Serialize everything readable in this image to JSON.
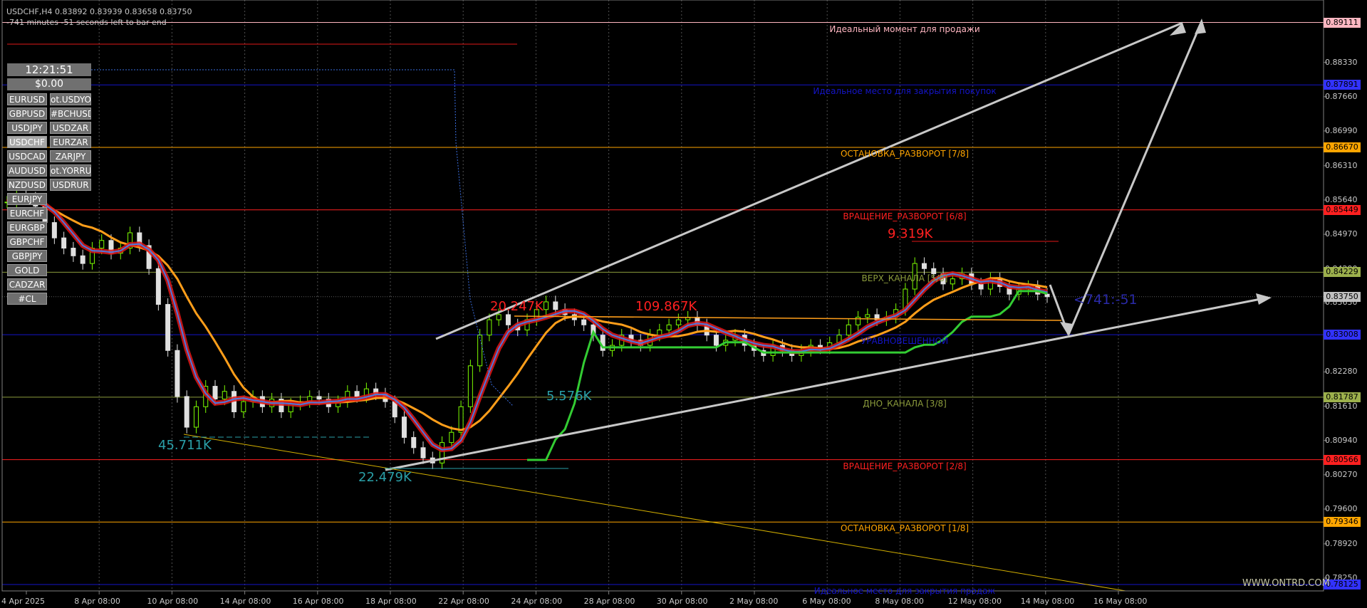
{
  "header": {
    "symbol_line": "USDCHF,H4  0.83892 0.83939 0.83658 0.83750",
    "timer_line": "-741 minutes -51 seconds left to bar end"
  },
  "panel": {
    "clock": "12:21:51",
    "balance": "$0.00",
    "symbols": [
      {
        "label": "EURUSD",
        "active": false
      },
      {
        "label": "ot.USDYO",
        "active": false
      },
      {
        "label": "GBPUSD",
        "active": false
      },
      {
        "label": "#BCHUSD",
        "active": false
      },
      {
        "label": "USDJPY",
        "active": false
      },
      {
        "label": "USDZAR",
        "active": false
      },
      {
        "label": "USDCHF",
        "active": true
      },
      {
        "label": "EURZAR",
        "active": false
      },
      {
        "label": "USDCAD",
        "active": false
      },
      {
        "label": "ZARJPY",
        "active": false
      },
      {
        "label": "AUDUSD",
        "active": false
      },
      {
        "label": "ot.YORRU",
        "active": false
      },
      {
        "label": "NZDUSD",
        "active": false
      },
      {
        "label": "USDRUR",
        "active": false
      },
      {
        "label": "EURJPY",
        "active": false
      },
      {
        "label": "",
        "active": false
      },
      {
        "label": "EURCHF",
        "active": false
      },
      {
        "label": "",
        "active": false
      },
      {
        "label": "EURGBP",
        "active": false
      },
      {
        "label": "",
        "active": false
      },
      {
        "label": "GBPCHF",
        "active": false
      },
      {
        "label": "",
        "active": false
      },
      {
        "label": "GBPJPY",
        "active": false
      },
      {
        "label": "",
        "active": false
      },
      {
        "label": "GOLD",
        "active": false
      },
      {
        "label": "",
        "active": false
      },
      {
        "label": "CADZAR",
        "active": false
      },
      {
        "label": "",
        "active": false
      },
      {
        "label": "#CL",
        "active": false
      },
      {
        "label": "",
        "active": false
      }
    ]
  },
  "watermark": "WWW.ONTRD.COM",
  "chart_data": {
    "type": "candlestick",
    "symbol": "USDCHF",
    "timeframe": "H4",
    "ylim": [
      0.78,
      0.8955
    ],
    "y_ticks": [
      "0.88330",
      "0.87660",
      "0.86990",
      "0.86310",
      "0.85640",
      "0.84970",
      "0.84290",
      "0.83630",
      "0.82950",
      "0.82280",
      "0.81610",
      "0.80940",
      "0.80270",
      "0.79600",
      "0.78920",
      "0.78250"
    ],
    "x_ticks": [
      "4 Apr 2025",
      "8 Apr 08:00",
      "10 Apr 08:00",
      "14 Apr 08:00",
      "16 Apr 08:00",
      "18 Apr 08:00",
      "22 Apr 08:00",
      "24 Apr 08:00",
      "28 Apr 08:00",
      "30 Apr 08:00",
      "2 May 08:00",
      "6 May 08:00",
      "8 May 08:00",
      "12 May 08:00",
      "14 May 08:00",
      "16 May 08:00"
    ],
    "close_series": [
      0.856,
      0.8575,
      0.8568,
      0.8552,
      0.852,
      0.849,
      0.847,
      0.8455,
      0.844,
      0.847,
      0.8485,
      0.846,
      0.847,
      0.85,
      0.8475,
      0.843,
      0.836,
      0.827,
      0.818,
      0.812,
      0.816,
      0.82,
      0.8175,
      0.819,
      0.815,
      0.817,
      0.818,
      0.816,
      0.8175,
      0.815,
      0.8165,
      0.817,
      0.818,
      0.8175,
      0.816,
      0.817,
      0.819,
      0.818,
      0.8195,
      0.8185,
      0.817,
      0.814,
      0.81,
      0.808,
      0.806,
      0.805,
      0.809,
      0.811,
      0.816,
      0.824,
      0.83,
      0.833,
      0.834,
      0.832,
      0.831,
      0.833,
      0.835,
      0.8365,
      0.835,
      0.834,
      0.833,
      0.832,
      0.83,
      0.827,
      0.828,
      0.83,
      0.829,
      0.828,
      0.83,
      0.831,
      0.832,
      0.833,
      0.8335,
      0.832,
      0.83,
      0.828,
      0.829,
      0.83,
      0.828,
      0.827,
      0.826,
      0.828,
      0.827,
      0.826,
      0.827,
      0.828,
      0.8275,
      0.8285,
      0.83,
      0.832,
      0.8335,
      0.834,
      0.833,
      0.8335,
      0.835,
      0.839,
      0.844,
      0.843,
      0.842,
      0.84,
      0.841,
      0.842,
      0.84,
      0.839,
      0.841,
      0.8395,
      0.838,
      0.839,
      0.8395,
      0.838,
      0.8375
    ],
    "levels": [
      {
        "price": "0.89111",
        "label": "Идеальный момент для продажи",
        "color": "#ffb6c1",
        "tag_bg": "#ffb6c1"
      },
      {
        "price": "0.87891",
        "label": "Идеальное место для закрытия покупок",
        "color": "#1414c8",
        "tag_bg": "#3232ff"
      },
      {
        "price": "0.86670",
        "label": "ОСТАНОВКА_РАЗВОРОТ [7/8]",
        "color": "#ffa500",
        "tag_bg": "#ffa500"
      },
      {
        "price": "0.85449",
        "label": "ВРАЩЕНИЕ_РАЗВОРОТ [6/8]",
        "color": "#ff2020",
        "tag_bg": "#ff2020"
      },
      {
        "price": "0.84229",
        "label": "ВЕРХ_КАНАЛА [5/8]",
        "color": "#8c9c3c",
        "tag_bg": "#9cb04c"
      },
      {
        "price": "0.83008",
        "label": "УРАВНОВЕШЕННОЙ",
        "color": "#1414c8",
        "tag_bg": "#3232ff"
      },
      {
        "price": "0.81787",
        "label": "ДНО_КАНАЛА [3/8]",
        "color": "#8c9c3c",
        "tag_bg": "#9cb04c"
      },
      {
        "price": "0.80566",
        "label": "ВРАЩЕНИЕ_РАЗВОРОТ [2/8]",
        "color": "#ff2020",
        "tag_bg": "#ff2020"
      },
      {
        "price": "0.79346",
        "label": "ОСТАНОВКА_РАЗВОРОТ [1/8]",
        "color": "#ffa500",
        "tag_bg": "#ffa500"
      },
      {
        "price": "0.78125",
        "label": "Идеальное место для закрытия продаж",
        "color": "#1414c8",
        "tag_bg": "#3232ff"
      }
    ],
    "current_price": "0.83750",
    "volume_labels": [
      {
        "text": "45.711K",
        "color": "#2aa0a8"
      },
      {
        "text": "22.479K",
        "color": "#2aa0a8"
      },
      {
        "text": "20.247K",
        "color": "#ff2020"
      },
      {
        "text": "109.867K",
        "color": "#ff2020"
      },
      {
        "text": "5.576K",
        "color": "#2aa0a8"
      },
      {
        "text": "9.319K",
        "color": "#ff2020"
      }
    ],
    "countdown": "<741:-51"
  }
}
